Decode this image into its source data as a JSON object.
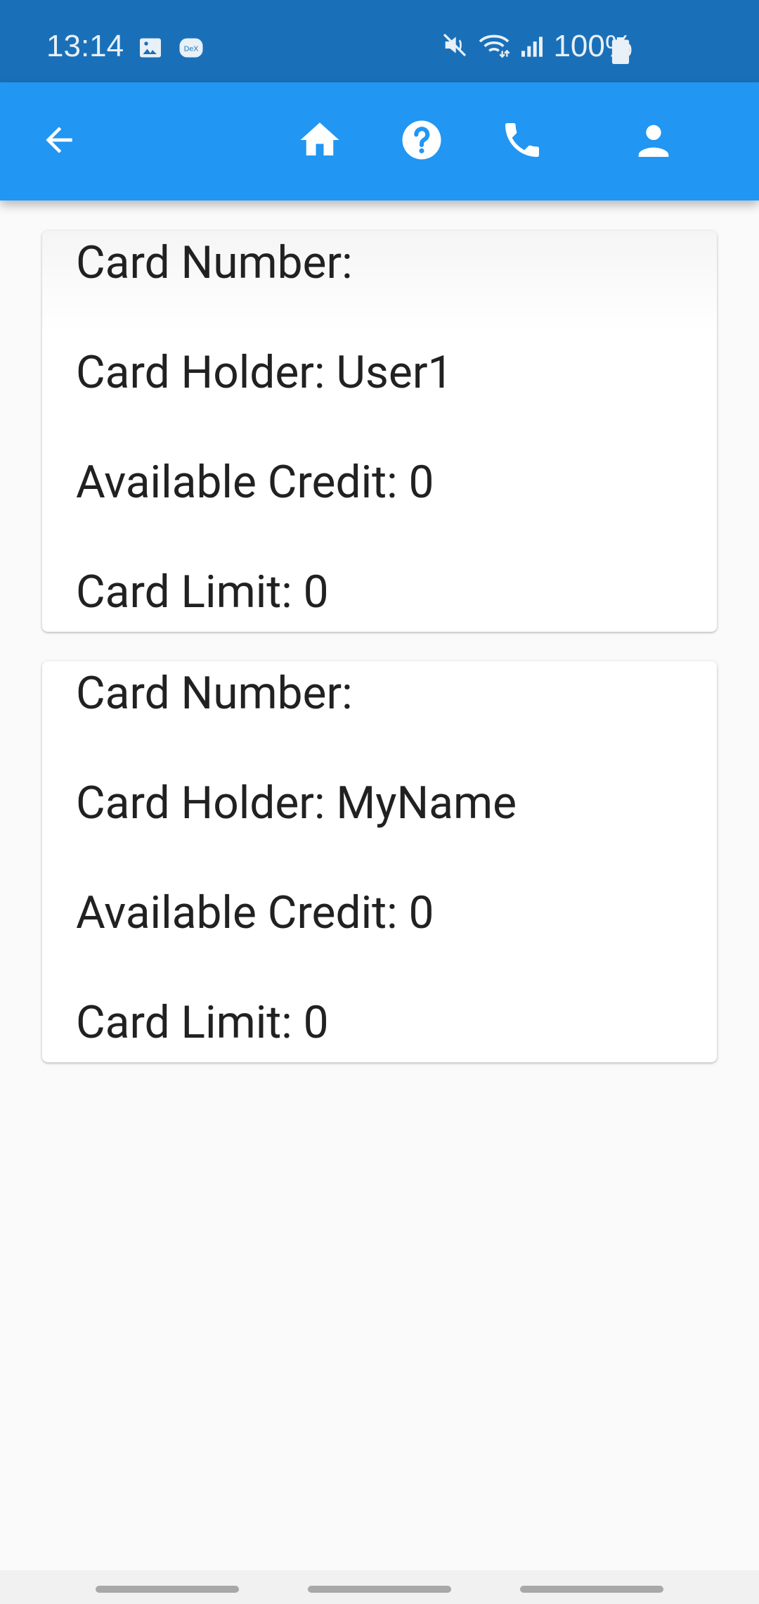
{
  "status_bar": {
    "time": "13:14",
    "battery_text": "100%",
    "icons": [
      "gallery-icon",
      "dex-icon",
      "mute-icon",
      "wifi-icon",
      "signal-icon",
      "battery-icon"
    ],
    "dex_label": "DeX"
  },
  "app_bar": {
    "color": "#2196f3",
    "actions": [
      "back-arrow-icon",
      "home-icon",
      "help-icon",
      "phone-icon",
      "person-icon"
    ]
  },
  "cards": [
    {
      "card_number": "Card Number:",
      "card_holder": "Card Holder: User1",
      "available_credit": "Available Credit: 0",
      "card_limit": "Card Limit: 0"
    },
    {
      "card_number": "Card Number:",
      "card_holder": "Card Holder: MyName",
      "available_credit": "Available Credit: 0",
      "card_limit": "Card Limit: 0"
    }
  ]
}
